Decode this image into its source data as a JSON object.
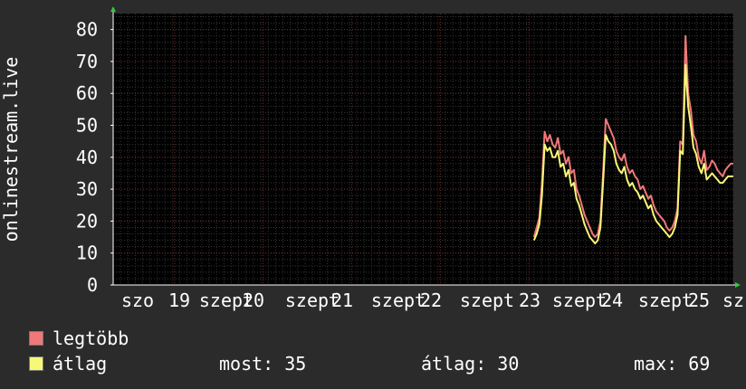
{
  "chart_data": {
    "type": "line",
    "ylabel": "onlinestream.live",
    "ylim": [
      0,
      85
    ],
    "yticks": [
      "0",
      "10",
      "20",
      "30",
      "40",
      "50",
      "60",
      "70",
      "80"
    ],
    "xlim": [
      0,
      7
    ],
    "x_tick_labels": [
      "szo",
      "19",
      "szept",
      "20",
      "szept",
      "21",
      "szept",
      "22",
      "szept",
      "23",
      "szept",
      "24",
      "szept",
      "25",
      "sz"
    ],
    "grid": true,
    "background": "#000000",
    "series": [
      {
        "name": "legtöbb",
        "color": "#f07878",
        "x": [
          4.75,
          4.78,
          4.81,
          4.84,
          4.87,
          4.9,
          4.93,
          4.96,
          4.99,
          5.02,
          5.05,
          5.08,
          5.11,
          5.14,
          5.17,
          5.2,
          5.23,
          5.26,
          5.29,
          5.32,
          5.35,
          5.38,
          5.41,
          5.44,
          5.47,
          5.5,
          5.53,
          5.56,
          5.59,
          5.62,
          5.65,
          5.68,
          5.71,
          5.74,
          5.77,
          5.8,
          5.83,
          5.86,
          5.89,
          5.92,
          5.95,
          5.98,
          6.01,
          6.04,
          6.07,
          6.1,
          6.13,
          6.16,
          6.19,
          6.22,
          6.25,
          6.28,
          6.31,
          6.34,
          6.37,
          6.4,
          6.43,
          6.46,
          6.49,
          6.52,
          6.55,
          6.58,
          6.61,
          6.64,
          6.67,
          6.7,
          6.73,
          6.76,
          6.79,
          6.82,
          6.85,
          6.88,
          6.91,
          6.94,
          6.97,
          7.0
        ],
        "values": [
          15,
          18,
          21,
          32,
          48,
          45,
          47,
          44,
          43,
          46,
          41,
          42,
          38,
          40,
          35,
          36,
          30,
          28,
          25,
          22,
          20,
          18,
          16,
          15,
          16,
          20,
          35,
          52,
          50,
          48,
          46,
          42,
          40,
          39,
          41,
          37,
          35,
          36,
          34,
          33,
          30,
          31,
          29,
          27,
          28,
          25,
          23,
          22,
          21,
          20,
          18,
          17,
          18,
          20,
          24,
          45,
          44,
          78,
          60,
          55,
          47,
          45,
          40,
          38,
          42,
          36,
          37,
          39,
          38,
          36,
          35,
          34,
          36,
          37,
          38,
          38
        ]
      },
      {
        "name": "átlag",
        "color": "#f8f878",
        "x": [
          4.75,
          4.78,
          4.81,
          4.84,
          4.87,
          4.9,
          4.93,
          4.96,
          4.99,
          5.02,
          5.05,
          5.08,
          5.11,
          5.14,
          5.17,
          5.2,
          5.23,
          5.26,
          5.29,
          5.32,
          5.35,
          5.38,
          5.41,
          5.44,
          5.47,
          5.5,
          5.53,
          5.56,
          5.59,
          5.62,
          5.65,
          5.68,
          5.71,
          5.74,
          5.77,
          5.8,
          5.83,
          5.86,
          5.89,
          5.92,
          5.95,
          5.98,
          6.01,
          6.04,
          6.07,
          6.1,
          6.13,
          6.16,
          6.19,
          6.22,
          6.25,
          6.28,
          6.31,
          6.34,
          6.37,
          6.4,
          6.43,
          6.46,
          6.49,
          6.52,
          6.55,
          6.58,
          6.61,
          6.64,
          6.67,
          6.7,
          6.73,
          6.76,
          6.79,
          6.82,
          6.85,
          6.88,
          6.91,
          6.94,
          6.97,
          7.0
        ],
        "values": [
          14,
          16,
          19,
          28,
          44,
          42,
          43,
          40,
          40,
          42,
          37,
          38,
          34,
          36,
          31,
          32,
          27,
          25,
          22,
          19,
          17,
          15,
          14,
          13,
          14,
          18,
          32,
          47,
          45,
          44,
          42,
          38,
          36,
          35,
          37,
          33,
          31,
          32,
          30,
          29,
          27,
          28,
          26,
          24,
          25,
          22,
          20,
          19,
          18,
          17,
          16,
          15,
          16,
          18,
          22,
          42,
          41,
          69,
          56,
          50,
          43,
          41,
          37,
          35,
          38,
          33,
          34,
          35,
          34,
          33,
          32,
          32,
          33,
          34,
          34,
          34
        ]
      }
    ]
  },
  "legend": [
    {
      "label": "legtöbb",
      "color": "#f07878"
    },
    {
      "label": "átlag",
      "color": "#f8f878"
    }
  ],
  "stats": {
    "now": "most: 35",
    "avg": "átlag: 30",
    "max": "max: 69"
  }
}
